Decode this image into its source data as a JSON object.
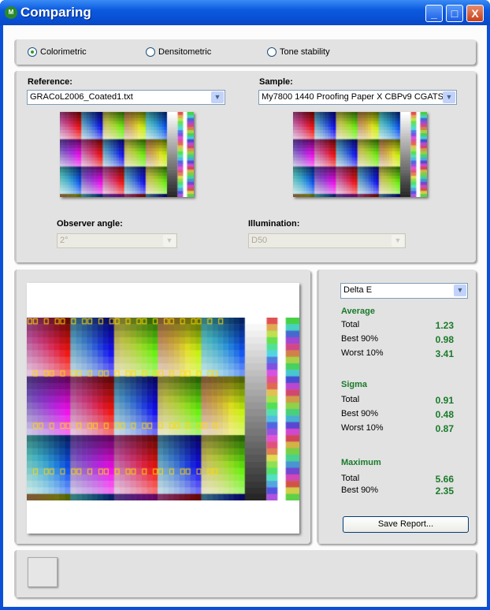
{
  "window": {
    "title": "Comparing",
    "minimize": "_",
    "maximize": "□",
    "close": "X"
  },
  "modes": [
    {
      "label": "Colorimetric",
      "selected": true
    },
    {
      "label": "Densitometric",
      "selected": false
    },
    {
      "label": "Tone stability",
      "selected": false
    }
  ],
  "reference": {
    "label": "Reference:",
    "value": "GRACoL2006_Coated1.txt"
  },
  "sample": {
    "label": "Sample:",
    "value": "My7800 1440 Proofing Paper X CBPv9 CGATS"
  },
  "observer": {
    "label": "Observer angle:",
    "value": "2°"
  },
  "illumination": {
    "label": "Illumination:",
    "value": "D50"
  },
  "stats": {
    "metric": "Delta E",
    "average": {
      "title": "Average",
      "rows": [
        {
          "k": "Total",
          "v": "1.23"
        },
        {
          "k": "Best 90%",
          "v": "0.98"
        },
        {
          "k": "Worst 10%",
          "v": "3.41"
        }
      ]
    },
    "sigma": {
      "title": "Sigma",
      "rows": [
        {
          "k": "Total",
          "v": "0.91"
        },
        {
          "k": "Best 90%",
          "v": "0.48"
        },
        {
          "k": "Worst 10%",
          "v": "0.87"
        }
      ]
    },
    "maximum": {
      "title": "Maximum",
      "rows": [
        {
          "k": "Total",
          "v": "5.66"
        },
        {
          "k": "Best 90%",
          "v": "2.35"
        }
      ]
    },
    "save_label": "Save Report..."
  },
  "colors": {
    "accent": "#1a7a2a",
    "titlebar": "#0b5ae0",
    "marker": "#ffd800"
  }
}
